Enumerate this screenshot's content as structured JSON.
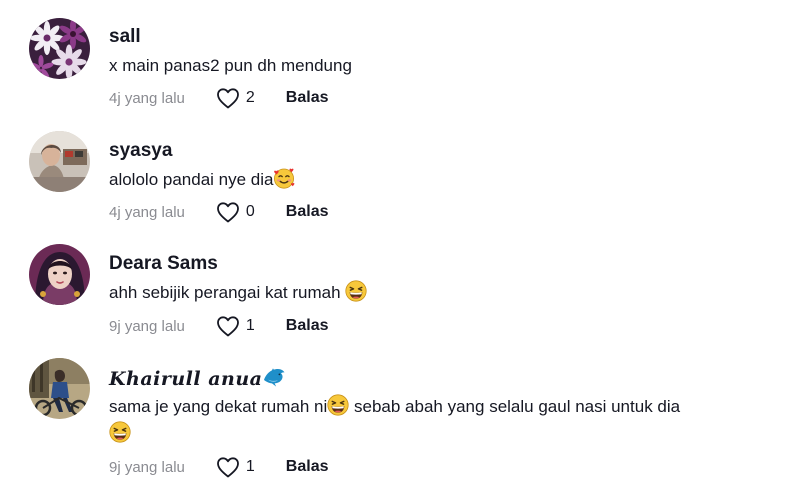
{
  "comments": [
    {
      "username": "sall",
      "text": "x main panas2 pun dh mendung",
      "time": "4j yang lalu",
      "likes": "2",
      "reply_label": "Balas",
      "avatar_icon": "purple-flowers-avatar"
    },
    {
      "username": "syasya",
      "text": "alololo pandai nye dia",
      "emoji": "smiling-face-with-hearts",
      "time": "4j yang lalu",
      "likes": "0",
      "reply_label": "Balas",
      "avatar_icon": "person-photo-avatar"
    },
    {
      "username": "Deara Sams",
      "text": "ahh sebijik perangai kat rumah",
      "emoji": "grinning-squinting-face",
      "time": "9j yang lalu",
      "likes": "1",
      "reply_label": "Balas",
      "avatar_icon": "hijab-selfie-avatar"
    },
    {
      "username": "Khairull anua",
      "username_emoji": "dolphin",
      "text_part1": "sama je yang dekat rumah ni",
      "text_part2": " sebab abah yang selalu gaul nasi untuk dia",
      "emoji": "grinning-squinting-face",
      "time": "9j yang lalu",
      "likes": "1",
      "reply_label": "Balas",
      "avatar_icon": "motorbike-rider-avatar"
    }
  ],
  "colors": {
    "text": "#161823",
    "muted": "#8a8b91",
    "background": "#ffffff"
  }
}
